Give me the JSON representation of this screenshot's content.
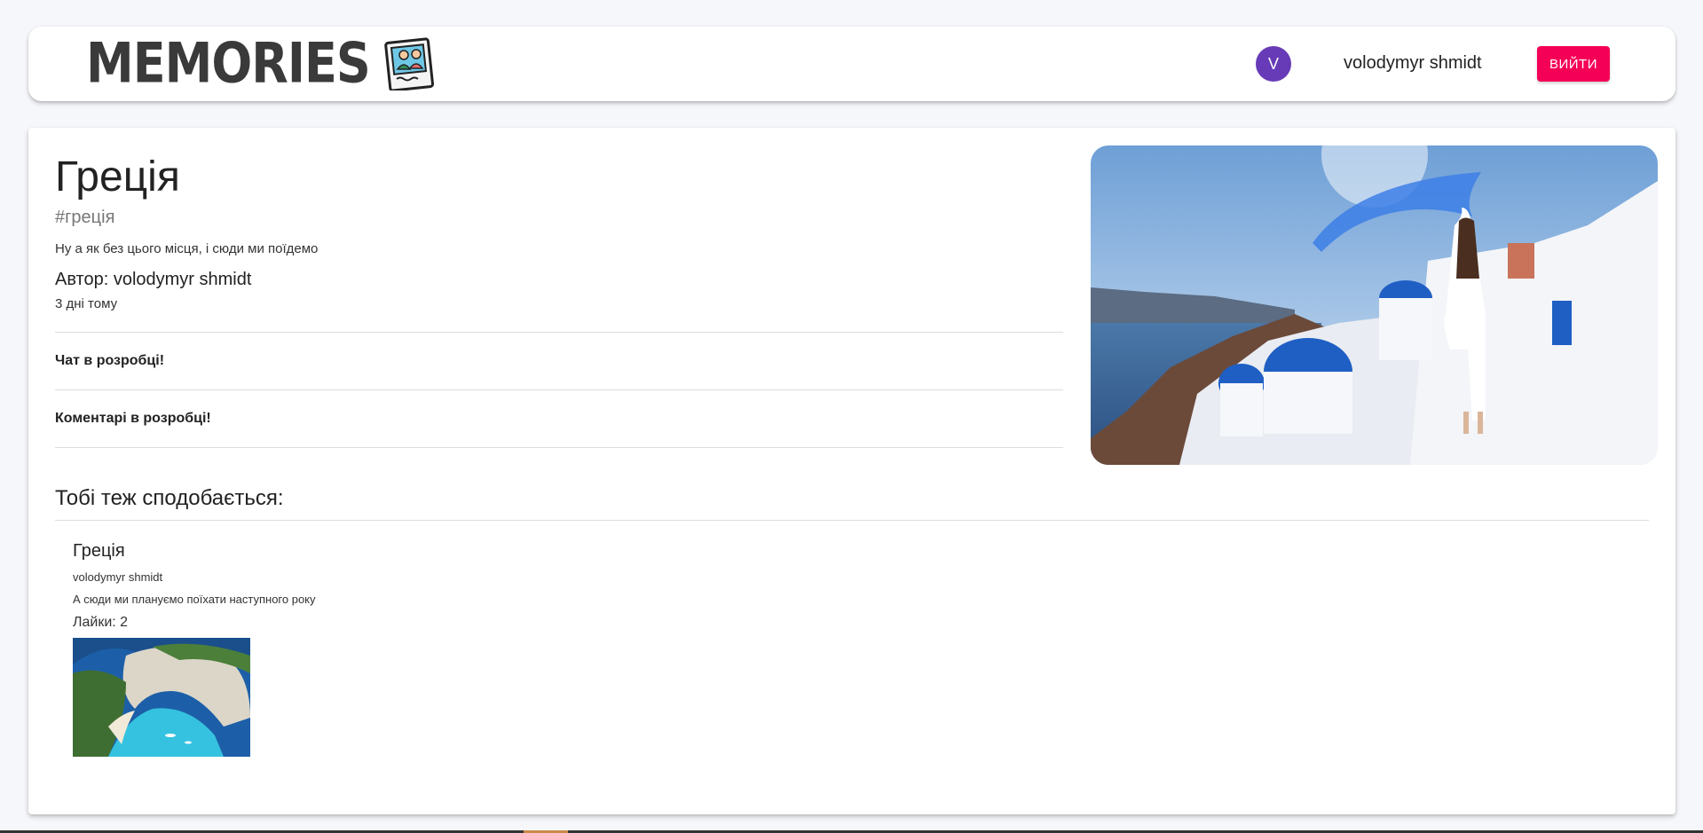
{
  "header": {
    "brand": "Memories",
    "user": {
      "avatar_letter": "V",
      "name": "volodymyr shmidt"
    },
    "logout_label": "ВИЙТИ"
  },
  "post": {
    "title": "Греція",
    "tags": "#греція",
    "message": "Ну а як без цього місця, і сюди ми поїдемо",
    "author": "Автор: volodymyr shmidt",
    "created": "3 дні тому",
    "chat_notice": "Чат в розробці!",
    "comments_notice": "Коментарі в розробці!"
  },
  "recommended": {
    "heading": "Тобі теж сподобається:",
    "items": [
      {
        "title": "Греція",
        "author": "volodymyr shmidt",
        "message": "А сюди ми плануємо поїхати наступного року",
        "likes": "Лайки: 2"
      }
    ]
  },
  "colors": {
    "accent": "#f50057",
    "avatar": "#673ab7",
    "background": "#f6f7fb"
  }
}
